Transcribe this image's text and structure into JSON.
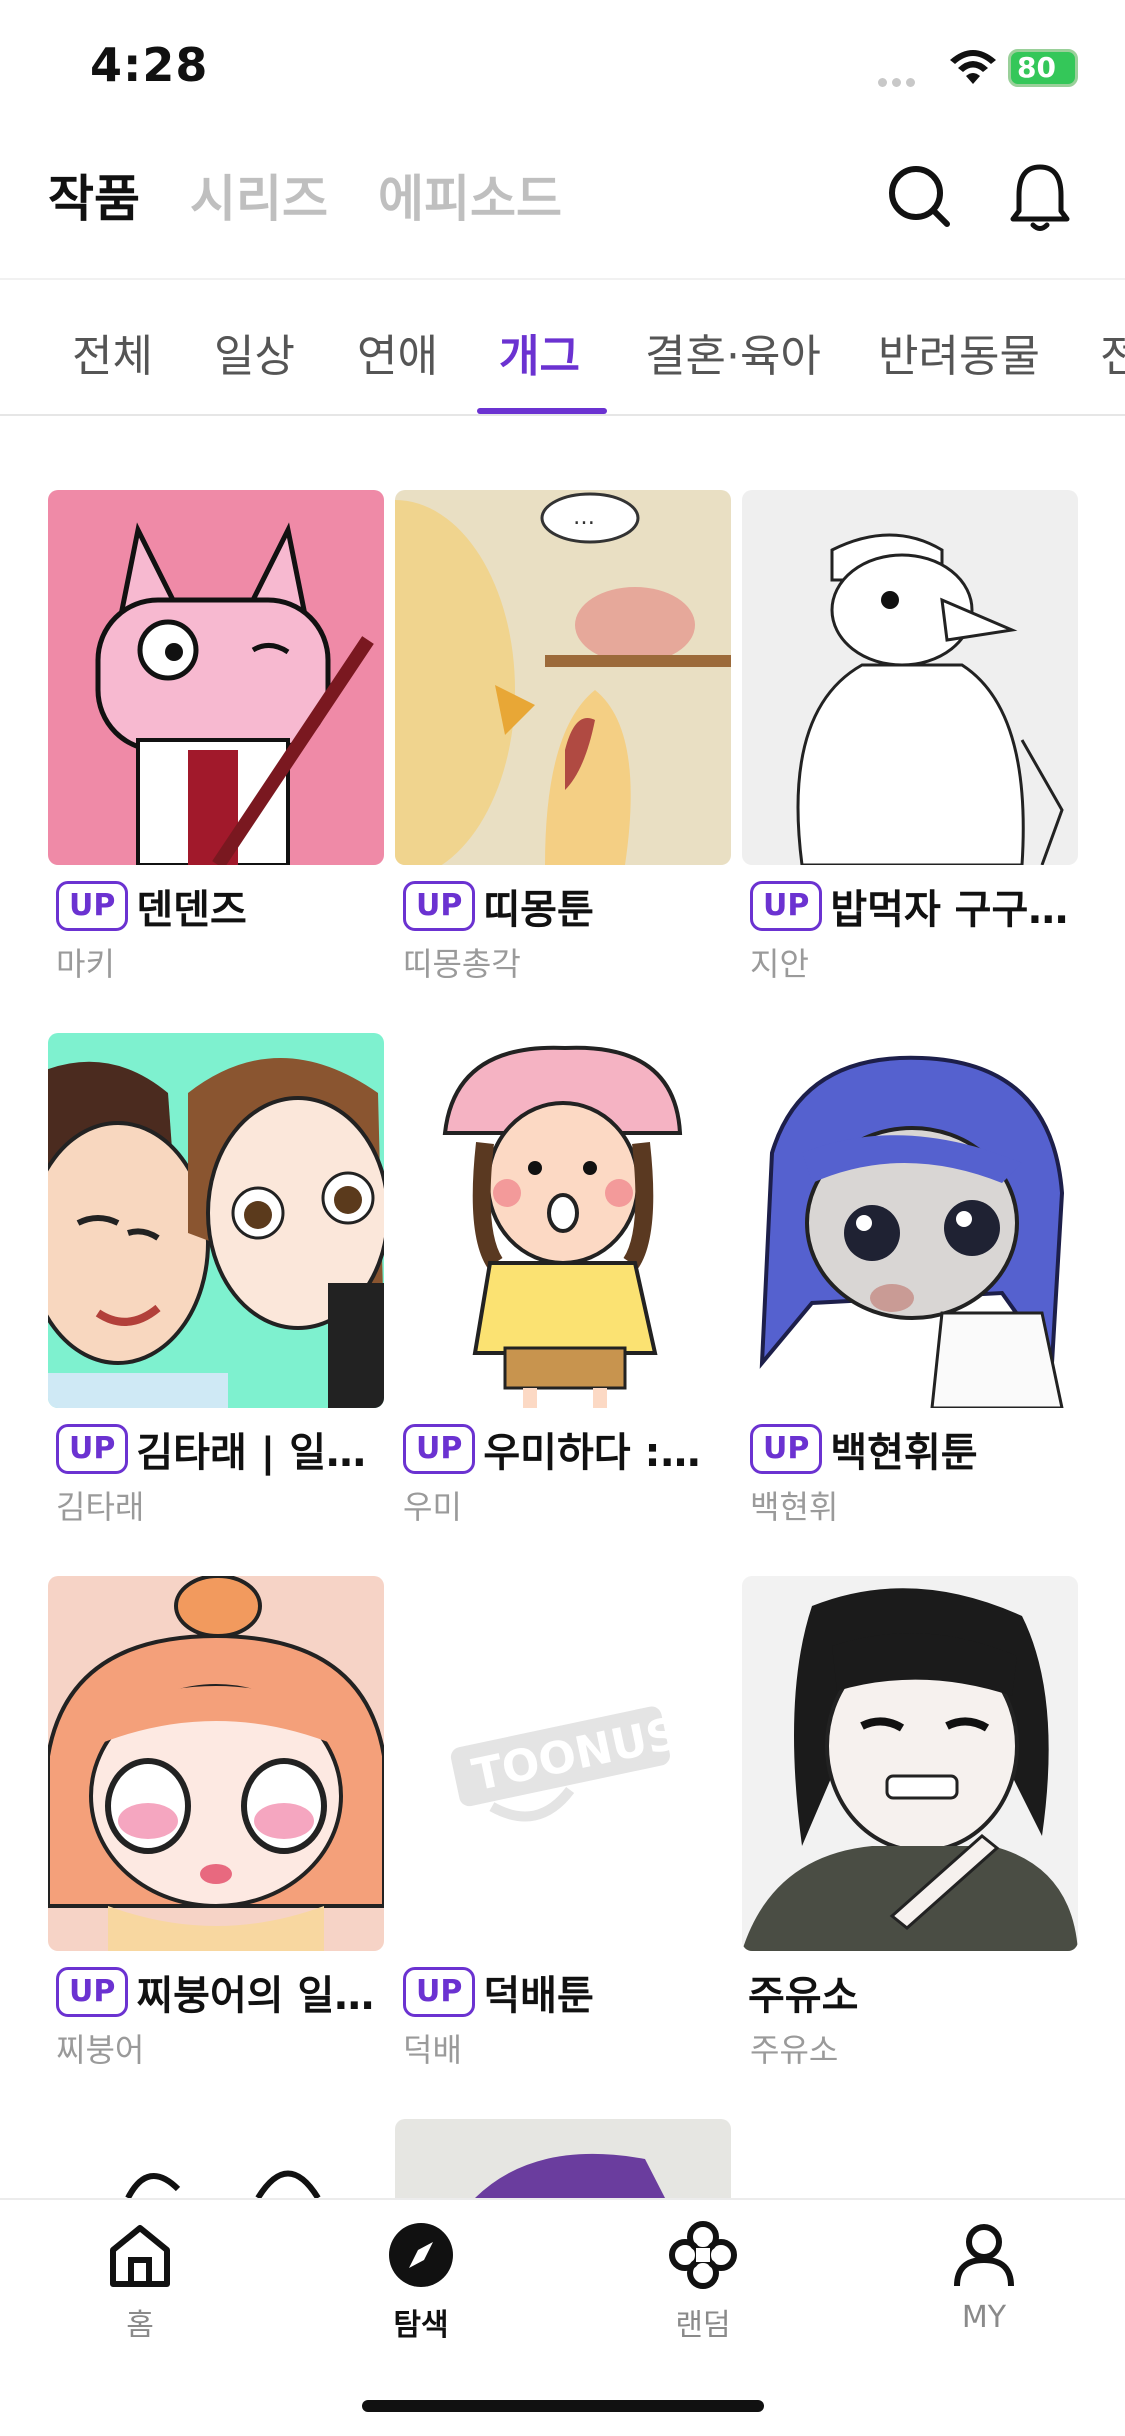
{
  "status_bar": {
    "time": "4:28",
    "battery": "80"
  },
  "top_tabs": [
    {
      "label": "작품",
      "active": true
    },
    {
      "label": "시리즈",
      "active": false
    },
    {
      "label": "에피소드",
      "active": false
    }
  ],
  "top_icons": {
    "search": "search-icon",
    "notifications": "bell-icon"
  },
  "categories": [
    {
      "label": "전체",
      "active": false
    },
    {
      "label": "일상",
      "active": false
    },
    {
      "label": "연애",
      "active": false
    },
    {
      "label": "개그",
      "active": true
    },
    {
      "label": "결혼·육아",
      "active": false
    },
    {
      "label": "반려동물",
      "active": false
    },
    {
      "label": "전",
      "active": false
    }
  ],
  "accent_color": "#6b32d1",
  "badge_label": "UP",
  "works": [
    {
      "title": "덴덴즈",
      "author": "마키",
      "up": true
    },
    {
      "title": "띠몽툰",
      "author": "띠몽총각",
      "up": true
    },
    {
      "title": "밥먹자 구구…",
      "author": "지안",
      "up": true
    },
    {
      "title": "김타래 | 일…",
      "author": "김타래",
      "up": true
    },
    {
      "title": "우미하다 :…",
      "author": "우미",
      "up": true
    },
    {
      "title": "백현휘툰",
      "author": "백현휘",
      "up": true
    },
    {
      "title": "찌붕어의 일…",
      "author": "찌붕어",
      "up": true
    },
    {
      "title": "덕배툰",
      "author": "덕배",
      "up": true,
      "placeholder_logo": "TOONUS"
    },
    {
      "title": "주유소",
      "author": "주유소",
      "up": false
    }
  ],
  "bottom_nav": [
    {
      "label": "홈",
      "icon": "home-icon",
      "active": false
    },
    {
      "label": "탐색",
      "icon": "compass-icon",
      "active": true
    },
    {
      "label": "랜덤",
      "icon": "clover-icon",
      "active": false
    },
    {
      "label": "MY",
      "icon": "person-icon",
      "active": false
    }
  ]
}
